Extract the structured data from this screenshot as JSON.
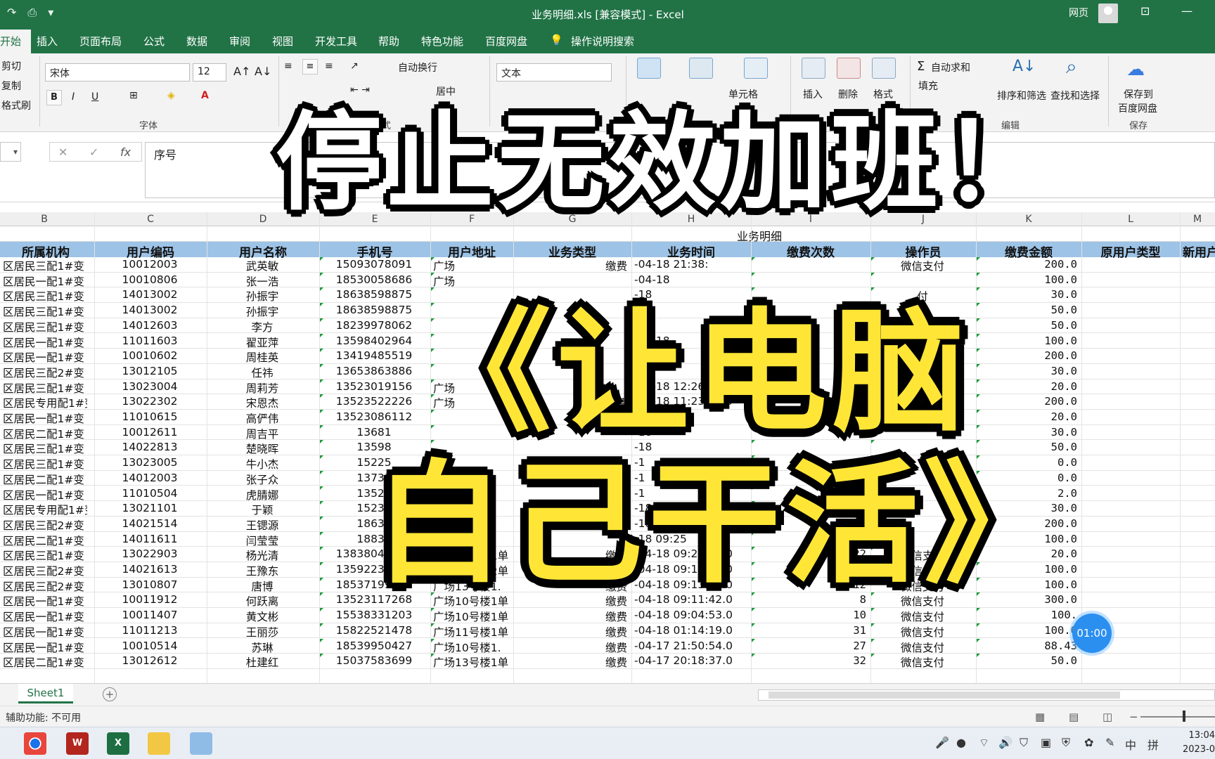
{
  "app": {
    "doc_title": "业务明细.xls  [兼容模式]  -  Excel",
    "user_label": "网页",
    "accent": "#217346"
  },
  "ribbon_tabs": [
    "开始",
    "插入",
    "页面布局",
    "公式",
    "数据",
    "审阅",
    "视图",
    "开发工具",
    "帮助",
    "特色功能",
    "百度网盘",
    "操作说明搜索"
  ],
  "ribbon": {
    "clipboard": {
      "cut": "剪切",
      "copy": "复制",
      "format_painter": "格式刷"
    },
    "font": {
      "name": "宋体",
      "size": "12",
      "bold": "B",
      "italic": "I",
      "underline": "U",
      "group_label": "字体"
    },
    "align": {
      "wrap": "自动换行",
      "merge": "居中",
      "group_label": "对齐方式"
    },
    "number": {
      "format": "文本"
    },
    "styles": {
      "cell_styles": "单元格"
    },
    "cells": {
      "insert": "插入",
      "delete": "删除",
      "format": "格式"
    },
    "editing": {
      "autosum": "自动求和",
      "fill": "填充",
      "sort": "排序和筛选",
      "find": "查找和选择",
      "group_label": "编辑"
    },
    "save": {
      "save_to": "保存到",
      "baidu": "百度网盘",
      "group_label": "保存"
    }
  },
  "formula_bar": {
    "value": "序号"
  },
  "columns": [
    "B",
    "C",
    "D",
    "E",
    "F",
    "G",
    "H",
    "I",
    "J",
    "K",
    "L",
    "M"
  ],
  "sheet_title": "业务明细",
  "headers": [
    "所属机构",
    "用户编码",
    "用户名称",
    "手机号",
    "用户地址",
    "业务类型",
    "业务时间",
    "缴费次数",
    "操作员",
    "缴费金额",
    "原用户类型",
    "新用户"
  ],
  "rows": [
    [
      "区居民三配1#变",
      "10012003",
      "武英敏",
      "15093078091",
      "广场",
      "缴费",
      "-04-18 21:38:",
      "",
      "微信支付",
      "200.0"
    ],
    [
      "区居民一配1#变",
      "10010806",
      "张一浩",
      "18530058686",
      "广场",
      "",
      "-04-18",
      "",
      "",
      "100.0"
    ],
    [
      "区居民三配1#变",
      "14013002",
      "孙振宇",
      "18638598875",
      "",
      "",
      "-18",
      "",
      "付",
      "30.0"
    ],
    [
      "区居民三配1#变",
      "14013002",
      "孙振宇",
      "18638598875",
      "",
      "",
      "-18",
      "",
      "付",
      "50.0"
    ],
    [
      "区居民三配1#变",
      "14012603",
      "李方",
      "18239978062",
      "",
      "",
      "-18",
      "",
      "付",
      "50.0"
    ],
    [
      "区居民一配1#变",
      "11011603",
      "翟亚萍",
      "13598402964",
      "",
      "",
      "-04-18",
      "",
      "付",
      "100.0"
    ],
    [
      "区居民一配1#变",
      "10010602",
      "周桂英",
      "13419485519",
      "",
      "",
      "-18",
      "",
      "付",
      "200.0"
    ],
    [
      "区居民三配2#变",
      "13012105",
      "任祎",
      "13653863886",
      "",
      "",
      "-18",
      "",
      "付",
      "30.0"
    ],
    [
      "区居民三配1#变",
      "13023004",
      "周莉芳",
      "13523019156",
      "广场",
      "",
      "-04-18 12:26:43",
      "",
      "付",
      "20.0"
    ],
    [
      "区居民专用配1#变",
      "13022302",
      "宋恩杰",
      "13523522226",
      "广场",
      "缴费",
      "-04-18 11:23:52.0",
      "",
      "付",
      "200.0"
    ],
    [
      "区居民一配1#变",
      "11010615",
      "高俨伟",
      "13523086112",
      "",
      "",
      "-04-18",
      "",
      "",
      "20.0"
    ],
    [
      "区居民二配1#变",
      "10012611",
      "周吉平",
      "13681",
      "",
      "",
      "-18",
      "",
      "",
      "30.0"
    ],
    [
      "区居民三配1#变",
      "14022813",
      "楚晓晖",
      "13598",
      "",
      "",
      "-18",
      "",
      "",
      "50.0"
    ],
    [
      "区居民三配1#变",
      "13023005",
      "牛小杰",
      "15225",
      "",
      "",
      "-1",
      "",
      "",
      "0.0"
    ],
    [
      "区居民二配1#变",
      "14012003",
      "张子众",
      "13733",
      "",
      "",
      "-1",
      "",
      "",
      "0.0"
    ],
    [
      "区居民一配1#变",
      "11010504",
      "虎腈娜",
      "13523",
      "",
      "",
      "-1",
      "",
      "",
      "2.0"
    ],
    [
      "区居民专用配1#变",
      "13021101",
      "于颖",
      "15237",
      "",
      "",
      "-18 09:37",
      "",
      "",
      "30.0"
    ],
    [
      "区居民三配2#变",
      "14021514",
      "王锶源",
      "18638",
      "",
      "",
      "-18 09:33",
      "",
      "",
      "200.0"
    ],
    [
      "区居民二配1#变",
      "14011611",
      "闫莹莹",
      "18838",
      "",
      "",
      "-18 09:25",
      "22",
      "",
      "100.0"
    ],
    [
      "区居民三配1#变",
      "13022903",
      "杨光清",
      "13838041027",
      "广场13号楼1单",
      "缴费",
      "-04-18 09:21:22.0",
      "22",
      "微信支付",
      "20.0"
    ],
    [
      "区居民三配2#变",
      "14021613",
      "王豫东",
      "13592236657",
      "广场14号楼2单",
      "缴费",
      "-04-18 09:17:51.0",
      "21",
      "微信支付",
      "100.0"
    ],
    [
      "区居民三配2#变",
      "13010807",
      "唐博",
      "18537199210",
      "广场13号楼1.",
      "缴费",
      "-04-18 09:13:35.0",
      "12",
      "微信支付",
      "100.0"
    ],
    [
      "区居民一配1#变",
      "10011912",
      "何跃离",
      "13523117268",
      "广场10号楼1单",
      "缴费",
      "-04-18 09:11:42.0",
      "8",
      "微信支付",
      "300.0"
    ],
    [
      "区居民一配1#变",
      "10011407",
      "黄文彬",
      "15538331203",
      "广场10号楼1单",
      "缴费",
      "-04-18 09:04:53.0",
      "10",
      "微信支付",
      "100."
    ],
    [
      "区居民一配1#变",
      "11011213",
      "王丽莎",
      "15822521478",
      "广场11号楼1单",
      "缴费",
      "-04-18 01:14:19.0",
      "31",
      "微信支付",
      "100.0"
    ],
    [
      "区居民一配1#变",
      "10010514",
      "苏琳",
      "18539950427",
      "广场10号楼1.",
      "缴费",
      "-04-17 21:50:54.0",
      "27",
      "微信支付",
      "88.43"
    ],
    [
      "区居民二配1#变",
      "13012612",
      "杜建红",
      "15037583699",
      "广场13号楼1单",
      "缴费",
      "-04-17 20:18:37.0",
      "32",
      "微信支付",
      "50.0"
    ]
  ],
  "sheet_tab": "Sheet1",
  "status": {
    "accessibility": "辅助功能: 不可用"
  },
  "timer": "01:00",
  "clock": {
    "time": "13:04",
    "date": "2023-0"
  },
  "overlay": {
    "headline": "停止无效加班！",
    "line1": "《让电脑",
    "line2": "自己干活》",
    "headline_color": "#ffffff",
    "sub_color": "#ffe636"
  },
  "taskbar": {
    "apps": [
      "chrome-icon",
      "wps-icon",
      "excel-icon",
      "folder-icon",
      "notes-icon"
    ],
    "ime": "中",
    "ime2": "拼"
  }
}
